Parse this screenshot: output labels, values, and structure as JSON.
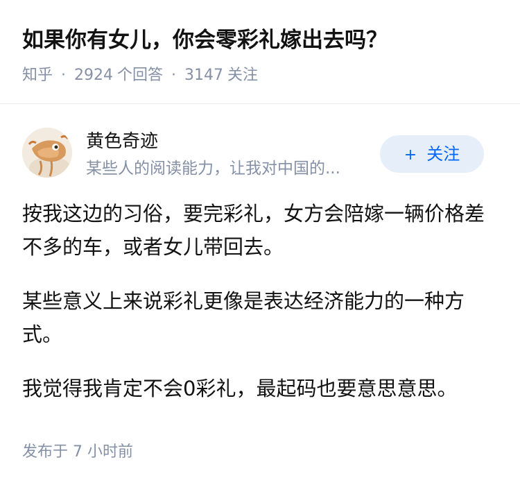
{
  "question": {
    "title": "如果你有女儿，你会零彩礼嫁出去吗？",
    "source": "知乎",
    "answer_count": "2924",
    "answer_label": "个回答",
    "follower_count": "3147",
    "follower_label": "关注",
    "separator": "·"
  },
  "author": {
    "name": "黄色奇迹",
    "bio": "某些人的阅读能力，让我对中国的...",
    "avatar_icon": "avatar-image",
    "follow_button": {
      "icon": "+",
      "label": "关注"
    }
  },
  "answer": {
    "paragraphs": [
      "按我这边的习俗，要完彩礼，女方会陪嫁一辆价格差不多的车，或者女儿带回去。",
      "某些意义上来说彩礼更像是表达经济能力的一种方式。",
      "我觉得我肯定不会0彩礼，最起码也要意思意思。"
    ],
    "publish_label": "发布于",
    "publish_time": "7 小时前"
  },
  "colors": {
    "accent": "#0066ff",
    "accent_bg": "#e6eefa",
    "meta_text": "#8590a6",
    "body_text": "#121212"
  }
}
